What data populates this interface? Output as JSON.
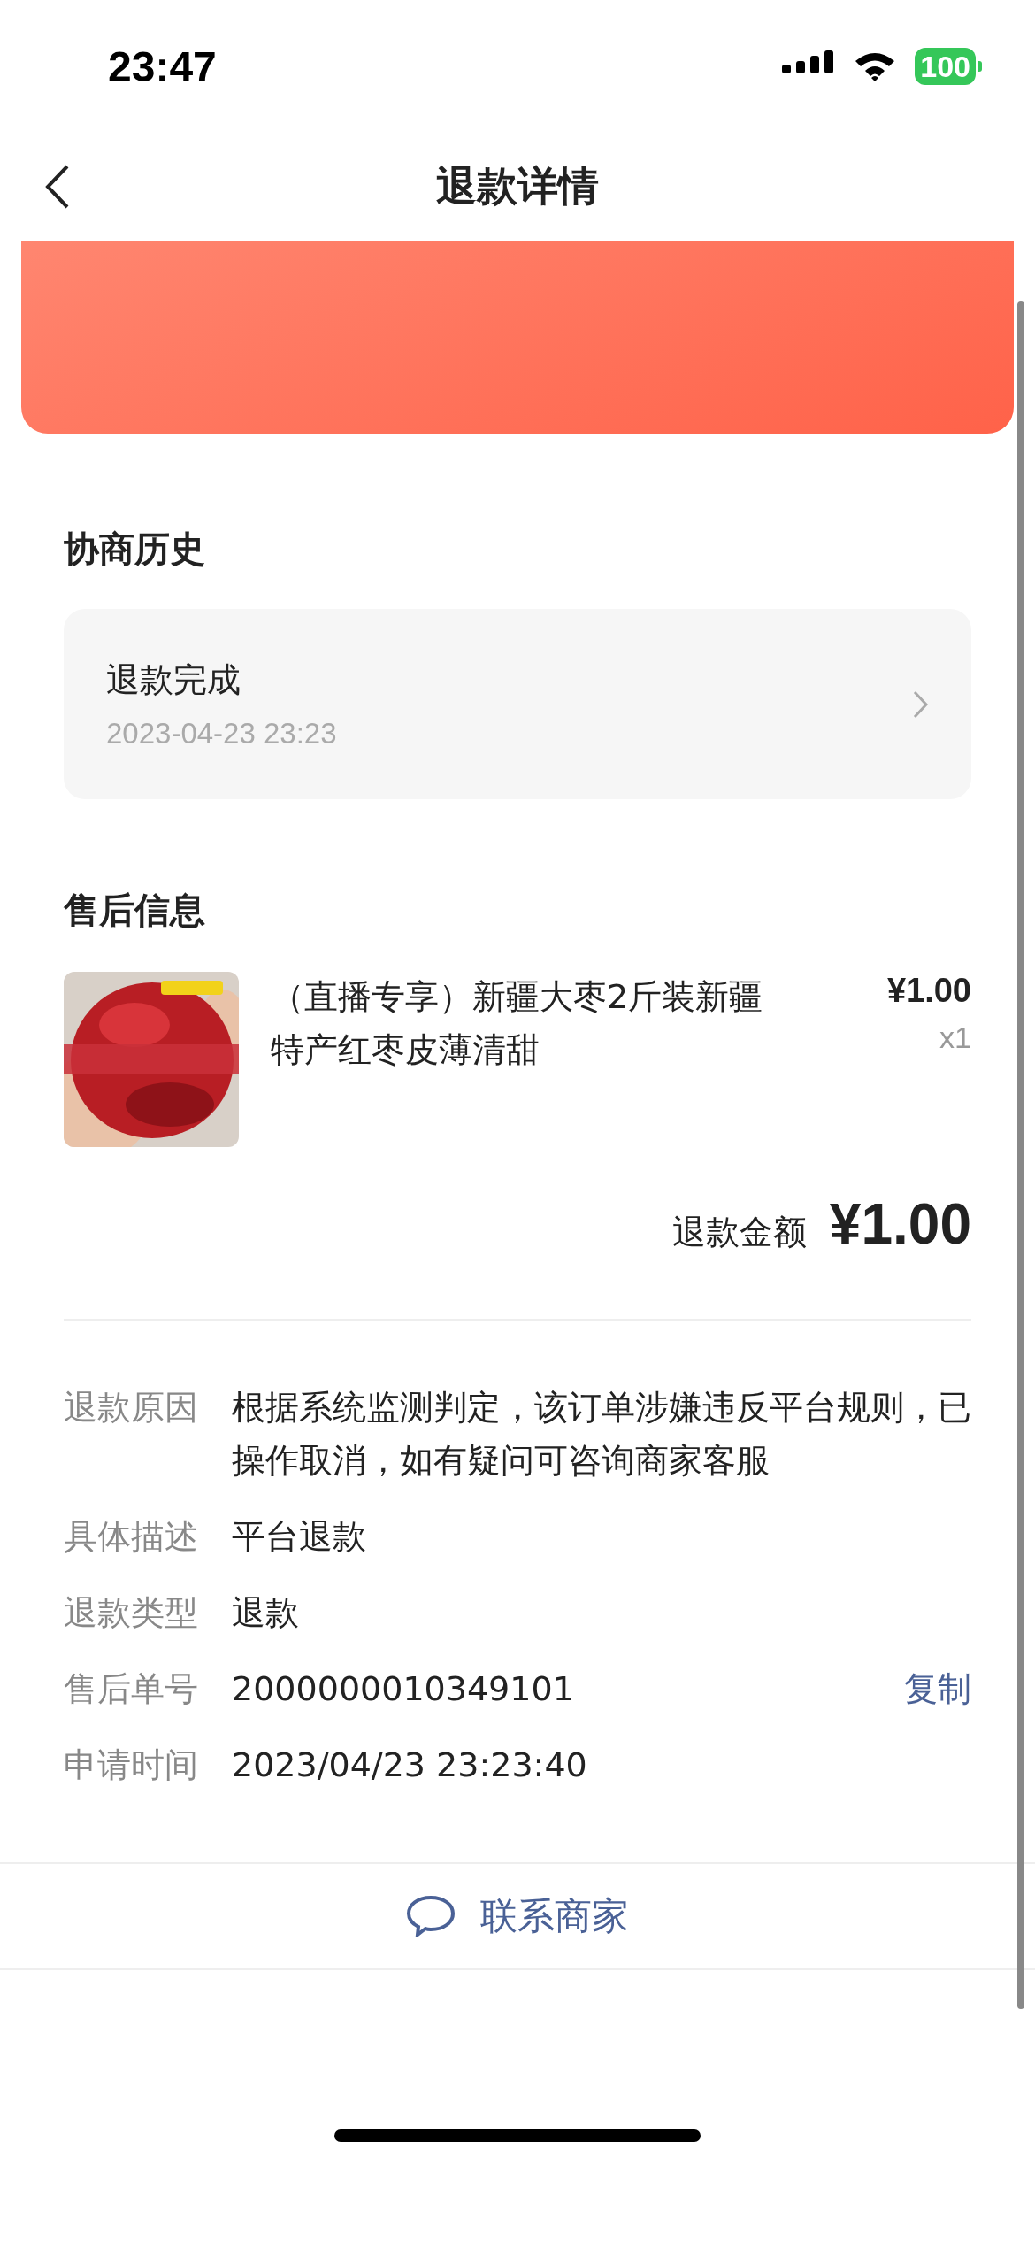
{
  "status_bar": {
    "time": "23:47",
    "battery": "100"
  },
  "nav": {
    "title": "退款详情"
  },
  "history": {
    "heading": "协商历史",
    "entries": [
      {
        "title": "退款完成",
        "time": "2023-04-23 23:23"
      }
    ]
  },
  "aftersale": {
    "heading": "售后信息",
    "product": {
      "title": "（直播专享）新疆大枣2斤装新疆特产红枣皮薄清甜",
      "price": "¥1.00",
      "quantity": "x1"
    },
    "refund_label": "退款金额",
    "refund_amount": "¥1.00",
    "details": [
      {
        "label": "退款原因",
        "value": "根据系统监测判定，该订单涉嫌违反平台规则，已操作取消，如有疑问可咨询商家客服"
      },
      {
        "label": "具体描述",
        "value": "平台退款"
      },
      {
        "label": "退款类型",
        "value": "退款"
      },
      {
        "label": "售后单号",
        "value": "2000000010349101",
        "action": "复制"
      },
      {
        "label": "申请时间",
        "value": "2023/04/23 23:23:40"
      }
    ]
  },
  "contact_button": "联系商家"
}
